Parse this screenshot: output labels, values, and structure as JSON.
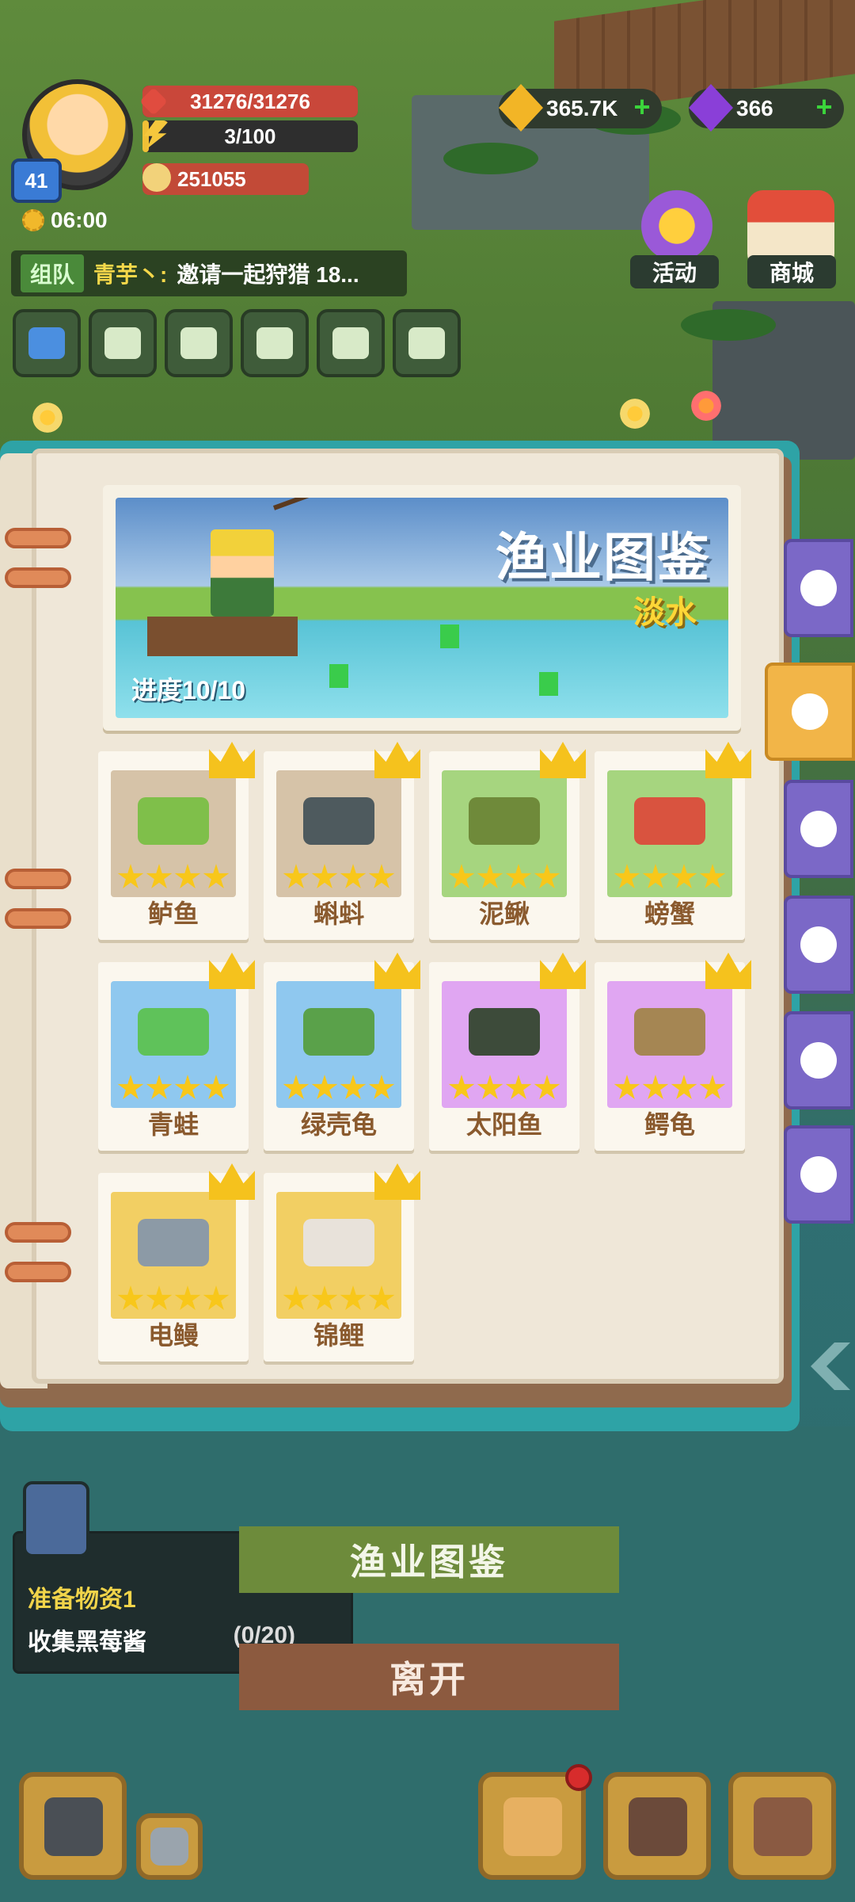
{
  "hud": {
    "level": "41",
    "time": "06:00",
    "hp": "31276/31276",
    "hp_fraction": 1.0,
    "exp": "3/100",
    "exp_fraction": 0.03,
    "power": "251055",
    "gold": "365.7K",
    "gems": "366",
    "event_label": "活动",
    "store_label": "商城"
  },
  "chat": {
    "tag": "组队",
    "sender": "青芋丶:",
    "message": "邀请一起狩猎 18..."
  },
  "book": {
    "title": "渔业图鉴",
    "subtitle": "淡水",
    "progress": "进度10/10",
    "cards": [
      {
        "name": "鲈鱼",
        "bg": "tan",
        "creature_color": "#7fbf4a"
      },
      {
        "name": "蝌蚪",
        "bg": "tan",
        "creature_color": "#4e5a5e"
      },
      {
        "name": "泥鳅",
        "bg": "green",
        "creature_color": "#6f8a3a"
      },
      {
        "name": "螃蟹",
        "bg": "green",
        "creature_color": "#d9533f"
      },
      {
        "name": "青蛙",
        "bg": "blue",
        "creature_color": "#5fc25a"
      },
      {
        "name": "绿壳龟",
        "bg": "blue",
        "creature_color": "#5aa14a"
      },
      {
        "name": "太阳鱼",
        "bg": "purple",
        "creature_color": "#3d4b3a"
      },
      {
        "name": "鳄龟",
        "bg": "purple",
        "creature_color": "#a58653"
      },
      {
        "name": "电鳗",
        "bg": "yellow",
        "creature_color": "#8c9aa6"
      },
      {
        "name": "锦鲤",
        "bg": "yellow",
        "creature_color": "#e8e2da"
      }
    ],
    "stars_per_card": 4
  },
  "side_tabs": [
    {
      "icon": "fish-hook-icon",
      "active": false
    },
    {
      "icon": "conch-shell-icon",
      "active": true
    },
    {
      "icon": "scallop-shell-icon",
      "active": false
    },
    {
      "icon": "octopus-icon",
      "active": false
    },
    {
      "icon": "starfish-icon",
      "active": false
    },
    {
      "icon": "flame-icon",
      "active": false
    }
  ],
  "quest": {
    "title": "准备物资1",
    "desc": "收集黑莓酱",
    "count": "(0/20)"
  },
  "buttons": {
    "fishery": "渔业图鉴",
    "leave": "离开"
  },
  "colors": {
    "tab_purple": "#7b68c7",
    "tab_active": "#f2b548",
    "star": "#f8c71a",
    "card_name": "#8a5a2e"
  }
}
